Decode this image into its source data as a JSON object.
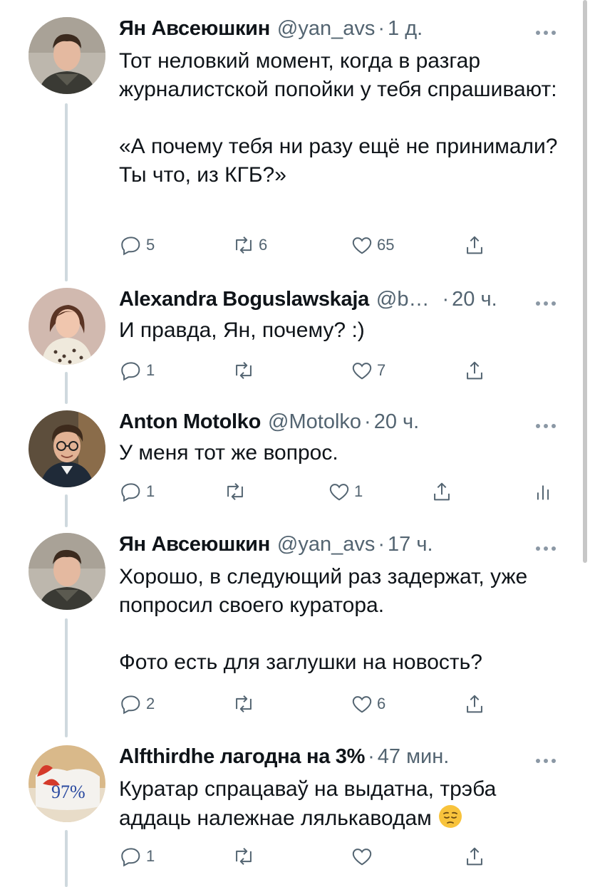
{
  "tweets": [
    {
      "name": "Ян Авсеюшкин",
      "handle": "@yan_avs",
      "time": "1 д.",
      "text": "Тот неловкий момент, когда в разгар журналистской попойки у тебя спрашивают:\n\n«А почему тебя ни разу ещё не принимали? Ты что, из КГБ?»",
      "replies": "5",
      "retweets": "6",
      "likes": "65"
    },
    {
      "name": "Alexandra Boguslawskaja",
      "handle": "@b…",
      "time": "20 ч.",
      "text": "И правда, Ян, почему? :)",
      "replies": "1",
      "retweets": "",
      "likes": "7"
    },
    {
      "name": "Anton Motolko",
      "handle": "@Motolko",
      "time": "20 ч.",
      "text": "У меня тот же вопрос.",
      "replies": "1",
      "retweets": "",
      "likes": "1"
    },
    {
      "name": "Ян Авсеюшкин",
      "handle": "@yan_avs",
      "time": "17 ч.",
      "text": "Хорошо, в следующий раз задержат, уже попросил своего куратора.\n\nФото есть для заглушки на новость?",
      "replies": "2",
      "retweets": "",
      "likes": "6"
    },
    {
      "name": "Alfthirdhe лагодна на 3%",
      "handle": "",
      "time": "47 мин.",
      "text": "Куратар спрацаваў на выдатна, трэба аддаць належнае лялькаводам",
      "replies": "1",
      "retweets": "",
      "likes": ""
    }
  ],
  "avatar5_badge": "97%",
  "colors": {
    "text": "#0f1419",
    "secondary": "#536471",
    "thread": "#cfd9de"
  },
  "icons": [
    "reply-icon",
    "retweet-icon",
    "like-icon",
    "share-icon",
    "more-icon",
    "analytics-icon",
    "pensive-face-emoji"
  ]
}
